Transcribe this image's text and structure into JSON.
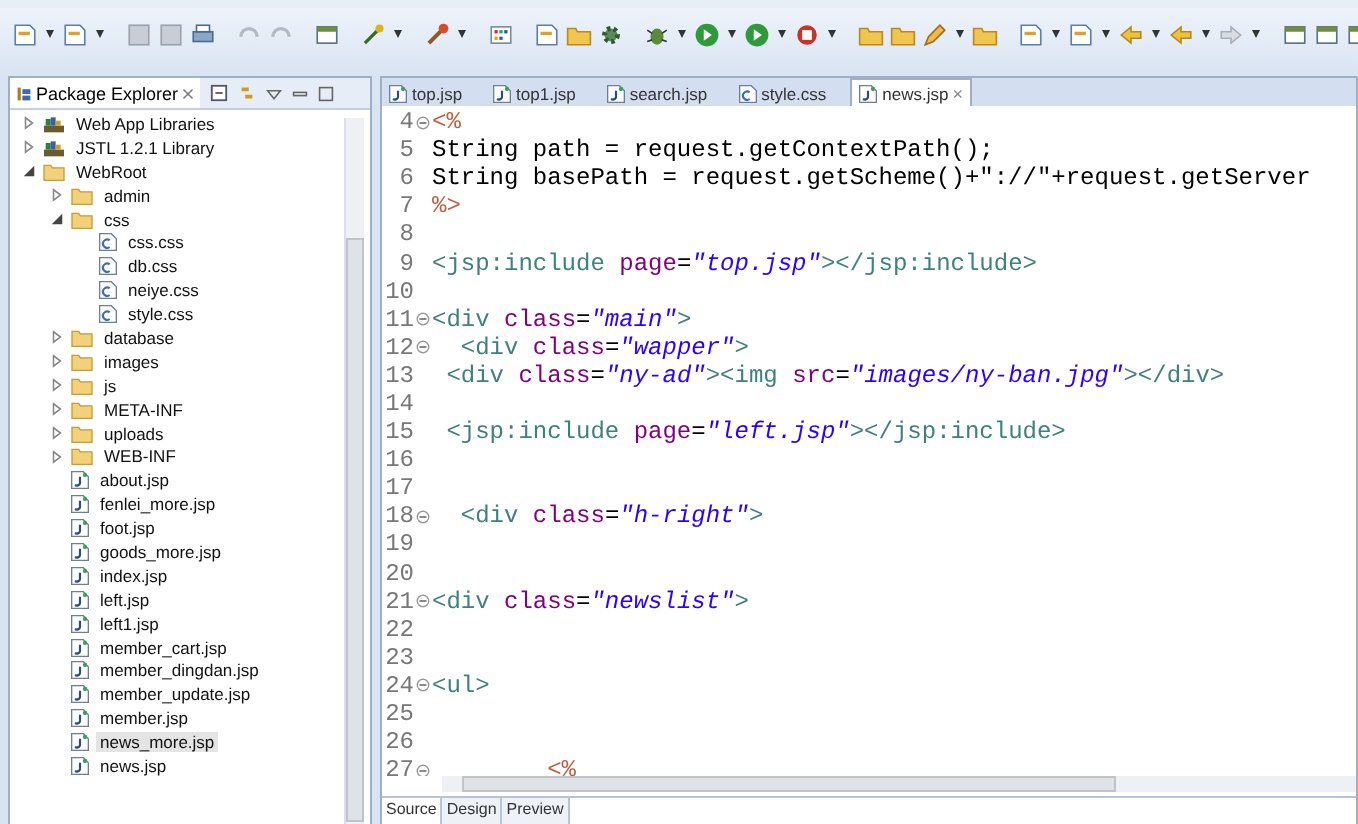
{
  "package_explorer": {
    "title": "Package Explorer",
    "items": [
      {
        "kind": "library",
        "label": "Web App Libraries",
        "expanded": false,
        "selected": false
      },
      {
        "kind": "library",
        "label": "JSTL 1.2.1 Library",
        "expanded": false,
        "selected": false
      },
      {
        "kind": "folder",
        "label": "WebRoot",
        "expanded": true,
        "selected": false,
        "children": [
          {
            "kind": "folder",
            "label": "admin",
            "expanded": false,
            "selected": false
          },
          {
            "kind": "folder",
            "label": "css",
            "expanded": true,
            "selected": false,
            "children": [
              {
                "kind": "css",
                "label": "css.css",
                "selected": false
              },
              {
                "kind": "css",
                "label": "db.css",
                "selected": false
              },
              {
                "kind": "css",
                "label": "neiye.css",
                "selected": false
              },
              {
                "kind": "css",
                "label": "style.css",
                "selected": false
              }
            ]
          },
          {
            "kind": "folder",
            "label": "database",
            "expanded": false,
            "selected": false
          },
          {
            "kind": "folder",
            "label": "images",
            "expanded": false,
            "selected": false
          },
          {
            "kind": "folder",
            "label": "js",
            "expanded": false,
            "selected": false
          },
          {
            "kind": "folder",
            "label": "META-INF",
            "expanded": false,
            "selected": false
          },
          {
            "kind": "folder",
            "label": "uploads",
            "expanded": false,
            "selected": false
          },
          {
            "kind": "folder",
            "label": "WEB-INF",
            "expanded": false,
            "selected": false
          },
          {
            "kind": "jsp",
            "label": "about.jsp",
            "selected": false
          },
          {
            "kind": "jsp",
            "label": "fenlei_more.jsp",
            "selected": false
          },
          {
            "kind": "jsp",
            "label": "foot.jsp",
            "selected": false
          },
          {
            "kind": "jsp",
            "label": "goods_more.jsp",
            "selected": false
          },
          {
            "kind": "jsp",
            "label": "index.jsp",
            "selected": false
          },
          {
            "kind": "jsp",
            "label": "left.jsp",
            "selected": false
          },
          {
            "kind": "jsp",
            "label": "left1.jsp",
            "selected": false
          },
          {
            "kind": "jsp",
            "label": "member_cart.jsp",
            "selected": false
          },
          {
            "kind": "jsp",
            "label": "member_dingdan.jsp",
            "selected": false
          },
          {
            "kind": "jsp",
            "label": "member_update.jsp",
            "selected": false
          },
          {
            "kind": "jsp",
            "label": "member.jsp",
            "selected": false
          },
          {
            "kind": "jsp",
            "label": "news_more.jsp",
            "selected": true
          },
          {
            "kind": "jsp",
            "label": "news.jsp",
            "selected": false
          }
        ]
      }
    ]
  },
  "editor": {
    "tabs": [
      {
        "label": "top.jsp",
        "kind": "jsp",
        "selected": false
      },
      {
        "label": "top1.jsp",
        "kind": "jsp",
        "selected": false
      },
      {
        "label": "search.jsp",
        "kind": "jsp",
        "selected": false
      },
      {
        "label": "style.css",
        "kind": "css",
        "selected": false
      },
      {
        "label": "news.jsp",
        "kind": "jsp",
        "selected": true,
        "close": "×"
      }
    ],
    "lines": [
      {
        "number": "4",
        "fold": true,
        "tokens": [
          {
            "kind": "jsp",
            "text": "<%"
          }
        ]
      },
      {
        "number": "5",
        "fold": false,
        "tokens": [
          {
            "kind": "plain",
            "text": "String path = request.getContextPath();"
          }
        ]
      },
      {
        "number": "6",
        "fold": false,
        "tokens": [
          {
            "kind": "plain",
            "text": "String basePath = request.getScheme()+\"://\"+request.getServer"
          }
        ]
      },
      {
        "number": "7",
        "fold": false,
        "tokens": [
          {
            "kind": "jsp",
            "text": "%>"
          }
        ]
      },
      {
        "number": "8",
        "fold": false
      },
      {
        "number": "9",
        "fold": false,
        "tokens": [
          {
            "kind": "tag",
            "text": "<jsp:include "
          },
          {
            "kind": "attr",
            "text": "page"
          },
          {
            "kind": "plain",
            "text": "="
          },
          {
            "kind": "value",
            "text": "\"top.jsp\""
          },
          {
            "kind": "tag",
            "text": "></jsp:include>"
          }
        ]
      },
      {
        "number": "10",
        "fold": false
      },
      {
        "number": "11",
        "fold": true,
        "tokens": [
          {
            "kind": "tag",
            "text": "<div "
          },
          {
            "kind": "attr",
            "text": "class"
          },
          {
            "kind": "plain",
            "text": "="
          },
          {
            "kind": "value",
            "text": "\"main\""
          },
          {
            "kind": "tag",
            "text": ">"
          }
        ]
      },
      {
        "number": "12",
        "fold": true,
        "tokens": [
          {
            "kind": "tag",
            "text": "  <div "
          },
          {
            "kind": "attr",
            "text": "class"
          },
          {
            "kind": "plain",
            "text": "="
          },
          {
            "kind": "value",
            "text": "\"wapper\""
          },
          {
            "kind": "tag",
            "text": ">"
          }
        ]
      },
      {
        "number": "13",
        "fold": false,
        "tokens": [
          {
            "kind": "tag",
            "text": " <div "
          },
          {
            "kind": "attr",
            "text": "class"
          },
          {
            "kind": "plain",
            "text": "="
          },
          {
            "kind": "value",
            "text": "\"ny-ad\""
          },
          {
            "kind": "tag",
            "text": "><img "
          },
          {
            "kind": "attr",
            "text": "src"
          },
          {
            "kind": "plain",
            "text": "="
          },
          {
            "kind": "value",
            "text": "\"images/ny-ban.jpg\""
          },
          {
            "kind": "tag",
            "text": "></div>"
          }
        ]
      },
      {
        "number": "14",
        "fold": false
      },
      {
        "number": "15",
        "fold": false,
        "tokens": [
          {
            "kind": "tag",
            "text": " <jsp:include "
          },
          {
            "kind": "attr",
            "text": "page"
          },
          {
            "kind": "plain",
            "text": "="
          },
          {
            "kind": "value",
            "text": "\"left.jsp\""
          },
          {
            "kind": "tag",
            "text": "></jsp:include>"
          }
        ]
      },
      {
        "number": "16",
        "fold": false
      },
      {
        "number": "17",
        "fold": false
      },
      {
        "number": "18",
        "fold": true,
        "tokens": [
          {
            "kind": "tag",
            "text": "  <div "
          },
          {
            "kind": "attr",
            "text": "class"
          },
          {
            "kind": "plain",
            "text": "="
          },
          {
            "kind": "value",
            "text": "\"h-right\""
          },
          {
            "kind": "tag",
            "text": ">"
          }
        ]
      },
      {
        "number": "19",
        "fold": false
      },
      {
        "number": "20",
        "fold": false
      },
      {
        "number": "21",
        "fold": true,
        "tokens": [
          {
            "kind": "tag",
            "text": "<div "
          },
          {
            "kind": "attr",
            "text": "class"
          },
          {
            "kind": "plain",
            "text": "="
          },
          {
            "kind": "value",
            "text": "\"newslist\""
          },
          {
            "kind": "tag",
            "text": ">"
          }
        ]
      },
      {
        "number": "22",
        "fold": false
      },
      {
        "number": "23",
        "fold": false
      },
      {
        "number": "24",
        "fold": true,
        "tokens": [
          {
            "kind": "tag",
            "text": "<ul>"
          }
        ]
      },
      {
        "number": "25",
        "fold": false
      },
      {
        "number": "26",
        "fold": false
      },
      {
        "number": "27",
        "fold": true,
        "tokens": [
          {
            "kind": "jsp",
            "text": "        <%"
          }
        ]
      }
    ],
    "bottom_tabs": [
      {
        "label": "Source",
        "selected": true
      },
      {
        "label": "Design",
        "selected": false
      },
      {
        "label": "Preview",
        "selected": false
      }
    ]
  }
}
